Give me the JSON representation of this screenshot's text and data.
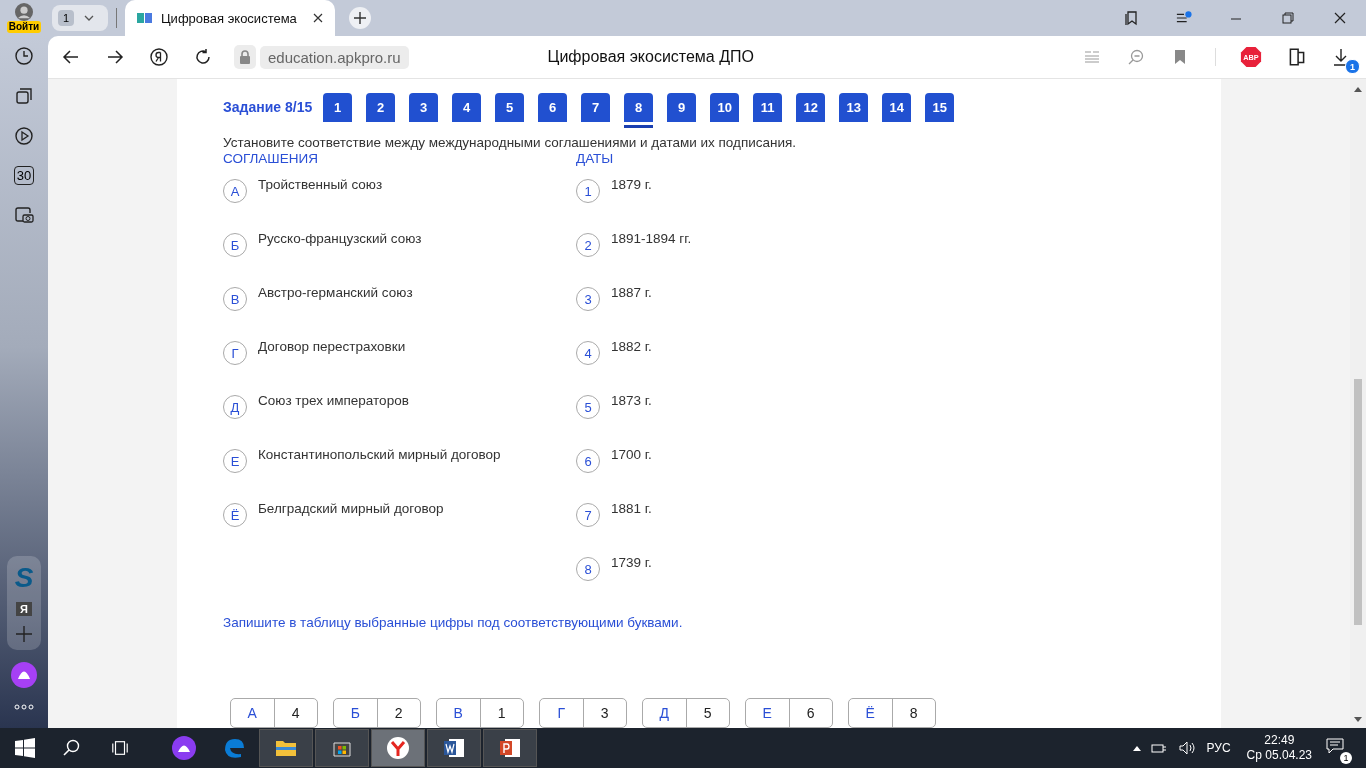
{
  "browser": {
    "profile_label": "Войти",
    "tab_count": "1",
    "tab_title": "Цифровая экосистема",
    "address": "education.apkpro.ru",
    "page_title": "Цифровая экосистема ДПО",
    "downloads_badge": "1",
    "adblock_label": "ABP"
  },
  "sidebar": {
    "calendar_label": "30",
    "service_logo": "S",
    "ya_label": "Я"
  },
  "task": {
    "label": "Задание 8/15",
    "steps": [
      {
        "label": "1",
        "selected": false
      },
      {
        "label": "2",
        "selected": false
      },
      {
        "label": "3",
        "selected": false
      },
      {
        "label": "4",
        "selected": false
      },
      {
        "label": "5",
        "selected": false
      },
      {
        "label": "6",
        "selected": false
      },
      {
        "label": "7",
        "selected": false
      },
      {
        "label": "8",
        "selected": true
      },
      {
        "label": "9",
        "selected": false
      },
      {
        "label": "10",
        "selected": false
      },
      {
        "label": "11",
        "selected": false
      },
      {
        "label": "12",
        "selected": false
      },
      {
        "label": "13",
        "selected": false
      },
      {
        "label": "14",
        "selected": false
      },
      {
        "label": "15",
        "selected": false
      }
    ]
  },
  "question": "Установите соответствие между международными соглашениями и датами их подписания.",
  "left_heading": "СОГЛАШЕНИЯ",
  "right_heading": "ДАТЫ",
  "agreements": [
    {
      "letter": "А",
      "text": "Тройственный союз"
    },
    {
      "letter": "Б",
      "text": "Русско-французский союз"
    },
    {
      "letter": "В",
      "text": "Австро-германский союз"
    },
    {
      "letter": "Г",
      "text": "Договор перестраховки"
    },
    {
      "letter": "Д",
      "text": "Союз трех императоров"
    },
    {
      "letter": "Е",
      "text": "Константинопольский мирный договор"
    },
    {
      "letter": "Ё",
      "text": "Белградский мирный договор"
    }
  ],
  "dates": [
    {
      "number": "1",
      "text": "1879 г."
    },
    {
      "number": "2",
      "text": "1891-1894 гг."
    },
    {
      "number": "3",
      "text": "1887 г."
    },
    {
      "number": "4",
      "text": "1882 г."
    },
    {
      "number": "5",
      "text": "1873 г."
    },
    {
      "number": "6",
      "text": "1700 г."
    },
    {
      "number": "7",
      "text": "1881 г."
    },
    {
      "number": "8",
      "text": "1739 г."
    }
  ],
  "instruction": "Запишите в таблицу выбранные цифры под соответствующими буквами.",
  "answers": [
    {
      "letter": "А",
      "value": "4"
    },
    {
      "letter": "Б",
      "value": "2"
    },
    {
      "letter": "В",
      "value": "1"
    },
    {
      "letter": "Г",
      "value": "3"
    },
    {
      "letter": "Д",
      "value": "5"
    },
    {
      "letter": "Е",
      "value": "6"
    },
    {
      "letter": "Ё",
      "value": "8"
    }
  ],
  "taskbar": {
    "apps": [
      {
        "kind": "assistant",
        "selected": false
      },
      {
        "kind": "edge",
        "selected": false
      },
      {
        "kind": "explorer",
        "selected": false
      },
      {
        "kind": "store",
        "selected": false
      },
      {
        "kind": "yandex",
        "selected": true
      },
      {
        "kind": "word",
        "selected": false
      },
      {
        "kind": "powerpoint",
        "selected": false
      }
    ],
    "language": "РУС",
    "time": "22:49",
    "date": "Ср 05.04.23",
    "notifications_badge": "1"
  }
}
